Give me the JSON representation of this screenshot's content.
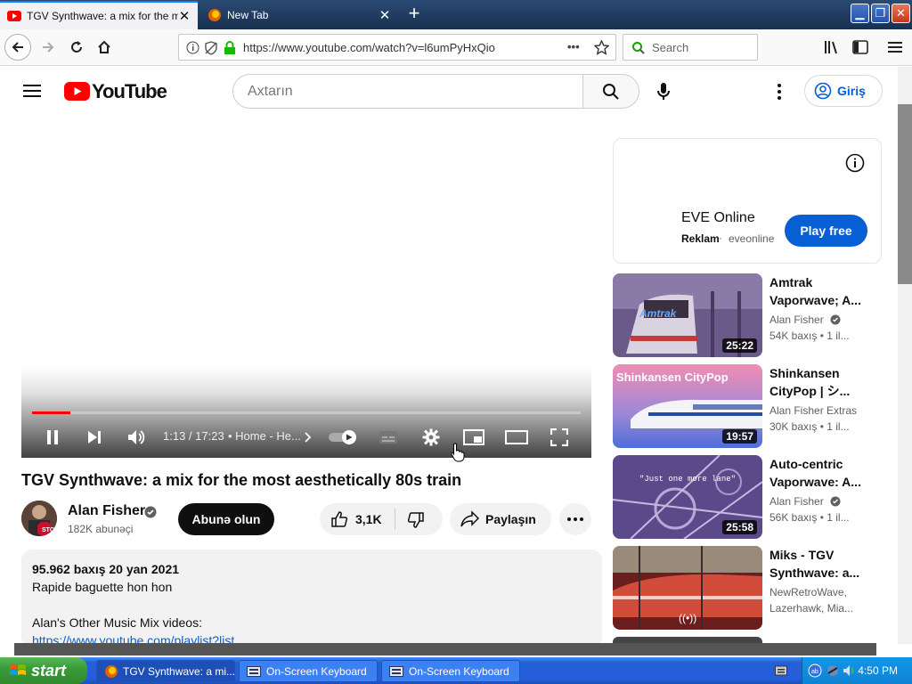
{
  "browser": {
    "tabs": [
      {
        "title": "TGV Synthwave: a mix for the mo",
        "active": true
      },
      {
        "title": "New Tab",
        "active": false
      }
    ],
    "new_tab_symbol": "+",
    "url": "https://www.youtube.com/watch?v=l6umPyHxQio",
    "url_more": "•••",
    "search_placeholder": "Search"
  },
  "youtube": {
    "logo_text": "YouTube",
    "search_placeholder": "Axtarın",
    "signin_label": "Giriş",
    "player": {
      "time": "1:13 / 17:23",
      "chapter": "• Home - He...",
      "progress": 0.07
    },
    "video": {
      "title": "TGV Synthwave: a mix for the most aesthetically 80s train",
      "channel": "Alan Fisher",
      "subscribers": "182K abunəçi",
      "subscribe_label": "Abunə olun",
      "likes": "3,1K",
      "share_label": "Paylaşın"
    },
    "description": {
      "stats": "95.962 baxış  20 yan 2021",
      "line1": "Rapide baguette hon hon",
      "other_videos": "Alan's Other Music Mix videos:",
      "link": "https://www.youtube.com/playlist?list"
    },
    "ad": {
      "title": "EVE Online",
      "label": "Reklam",
      "domain": "eveonline",
      "cta": "Play free"
    },
    "recommendations": [
      {
        "title": "Amtrak Vaporwave; A...",
        "channel": "Alan Fisher",
        "verified": true,
        "meta": "54K baxış  • 1 il...",
        "duration": "25:22",
        "thumb_text": "Amtrak",
        "colors": [
          "#6a5a8a",
          "#d9c7d6"
        ]
      },
      {
        "title": "Shinkansen CityPop | シ...",
        "channel": "Alan Fisher Extras",
        "verified": false,
        "meta": "30K baxış  • 1 il...",
        "duration": "19:57",
        "thumb_text": "Shinkansen CityPop",
        "colors": [
          "#f28db4",
          "#6b6fd8"
        ]
      },
      {
        "title": "Auto-centric Vaporwave: A...",
        "channel": "Alan Fisher",
        "verified": true,
        "meta": "56K baxış  • 1 il...",
        "duration": "25:58",
        "thumb_text": "\"Just one more lane\"",
        "colors": [
          "#4a3a7a",
          "#8a70b0"
        ]
      },
      {
        "title": "Miks - TGV Synthwave: a...",
        "channel": "NewRetroWave,",
        "verified": false,
        "meta": "Lazerhawk, Mia...",
        "duration": "((•))",
        "thumb_text": "",
        "colors": [
          "#7a1a1a",
          "#d24c3c"
        ]
      }
    ]
  },
  "taskbar": {
    "start_label": "start",
    "items": [
      {
        "label": "TGV Synthwave: a mi...",
        "active": true
      },
      {
        "label": "On-Screen Keyboard",
        "active": false
      },
      {
        "label": "On-Screen Keyboard",
        "active": false
      }
    ],
    "clock": "4:50 PM"
  }
}
